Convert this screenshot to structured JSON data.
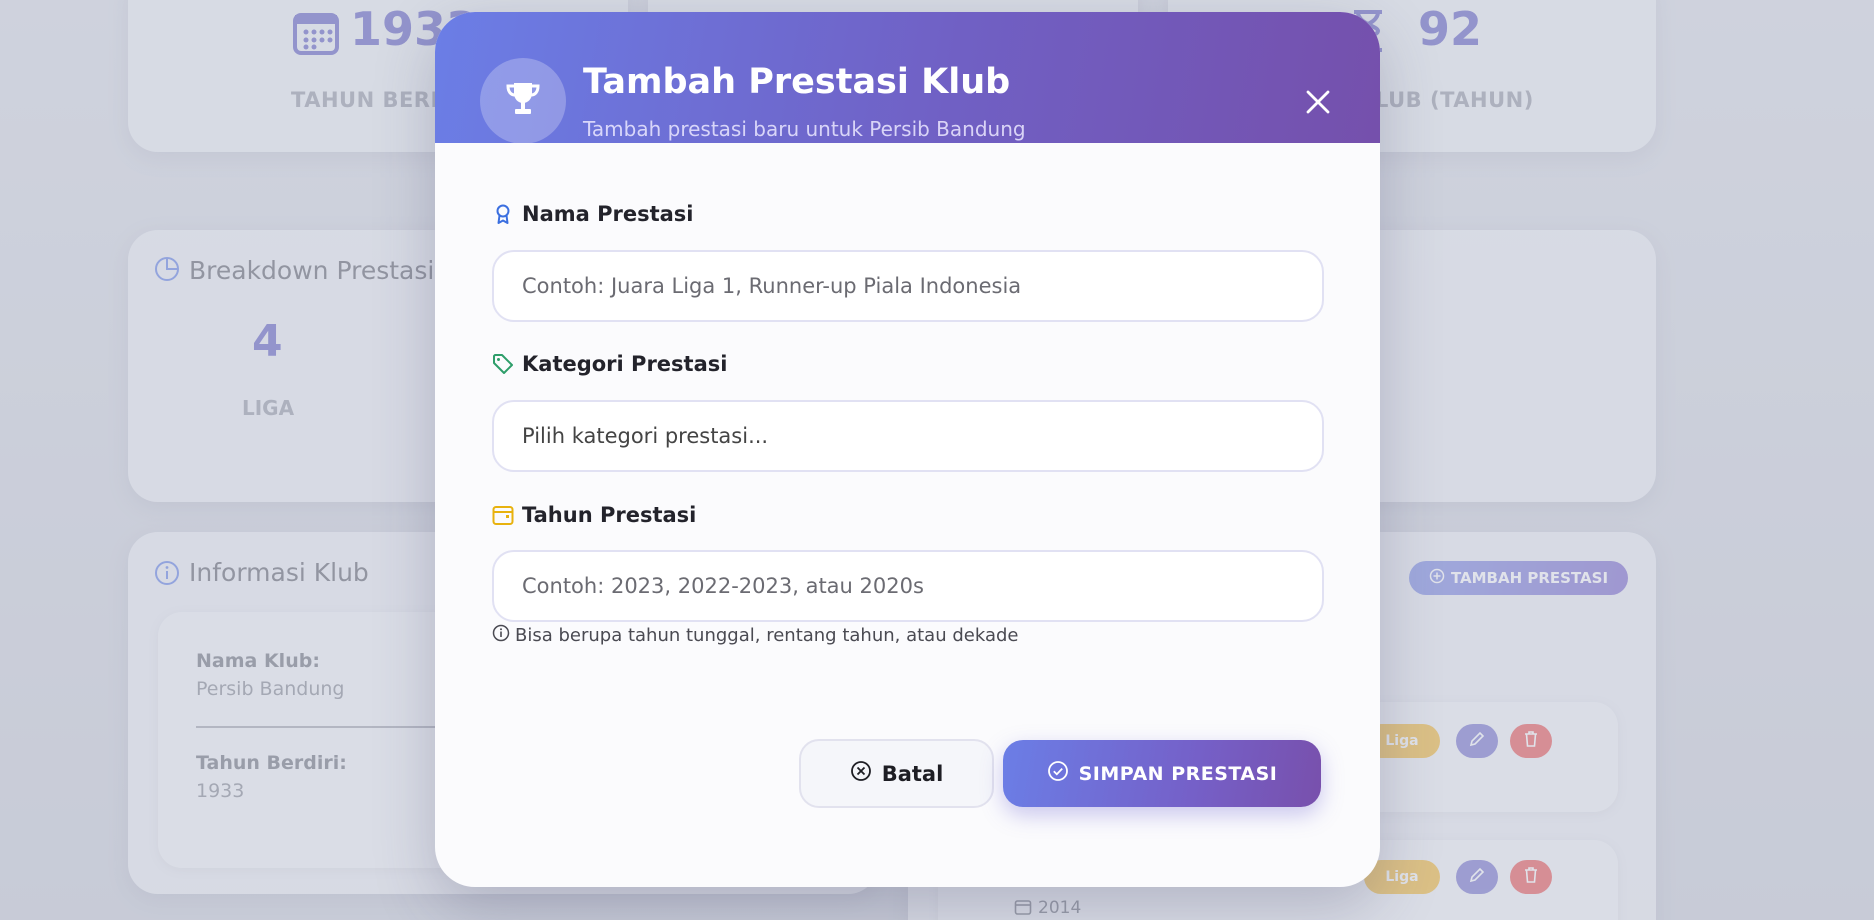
{
  "background": {
    "stats": [
      {
        "value": "1933",
        "label": "TAHUN BERDI"
      },
      {
        "value": "92",
        "label": "LUB (TAHUN)"
      }
    ],
    "breakdown": {
      "title": "Breakdown Prestasi",
      "count": "4",
      "category": "LIGA"
    },
    "info": {
      "title": "Informasi Klub",
      "club_name_label": "Nama Klub:",
      "club_name_value": "Persib Bandung",
      "founded_label": "Tahun Berdiri:",
      "founded_value": "1933"
    },
    "add_button": "TAMBAH PRESTASI",
    "rows": [
      {
        "tag": "Liga"
      },
      {
        "tag": "Liga",
        "year": "2014"
      }
    ]
  },
  "modal": {
    "title": "Tambah Prestasi Klub",
    "subtitle": "Tambah prestasi baru untuk Persib Bandung",
    "fields": {
      "name_label": "Nama Prestasi",
      "name_placeholder": "Contoh: Juara Liga 1, Runner-up Piala Indonesia",
      "category_label": "Kategori Prestasi",
      "category_value": "Pilih kategori prestasi...",
      "year_label": "Tahun Prestasi",
      "year_placeholder": "Contoh: 2023, 2022-2023, atau 2020s",
      "year_hint": "Bisa berupa tahun tunggal, rentang tahun, atau dekade"
    },
    "buttons": {
      "cancel": "Batal",
      "save": "SIMPAN PRESTASI"
    }
  },
  "colors": {
    "accent": "#6b7ee6",
    "accent_dark": "#7550ac",
    "liga_tag": "#f3b52a",
    "edit_btn": "#6e6bc9",
    "delete_btn": "#e84a4a"
  }
}
